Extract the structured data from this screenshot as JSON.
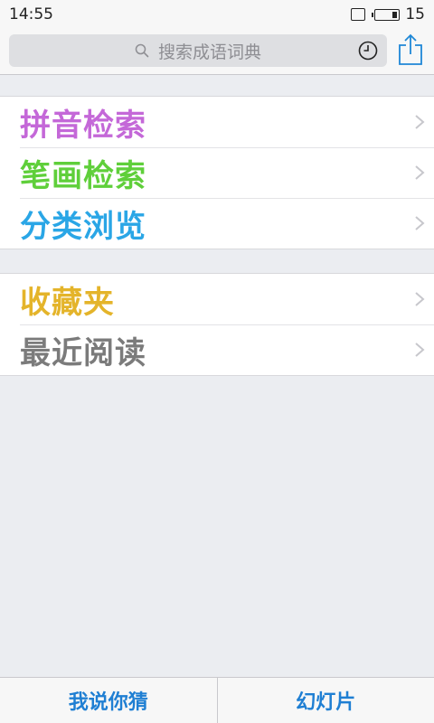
{
  "status_bar": {
    "time": "14:55",
    "battery_level": "15",
    "icons": [
      "sim-icon",
      "battery-icon"
    ]
  },
  "search": {
    "placeholder": "搜索成语词典",
    "icons": [
      "search-icon",
      "history-icon",
      "share-icon"
    ]
  },
  "menu_groups": [
    {
      "items": [
        {
          "label": "拼音检索",
          "color": "#c468d8"
        },
        {
          "label": "笔画检索",
          "color": "#5fcf3a"
        },
        {
          "label": "分类浏览",
          "color": "#2aa6e6"
        }
      ]
    },
    {
      "items": [
        {
          "label": "收藏夹",
          "color": "#e4b42a"
        },
        {
          "label": "最近阅读",
          "color": "#7b7b7b"
        }
      ]
    }
  ],
  "bottom_bar": {
    "tabs": [
      {
        "label": "我说你猜"
      },
      {
        "label": "幻灯片"
      }
    ],
    "accent_color": "#1f7fd3"
  }
}
